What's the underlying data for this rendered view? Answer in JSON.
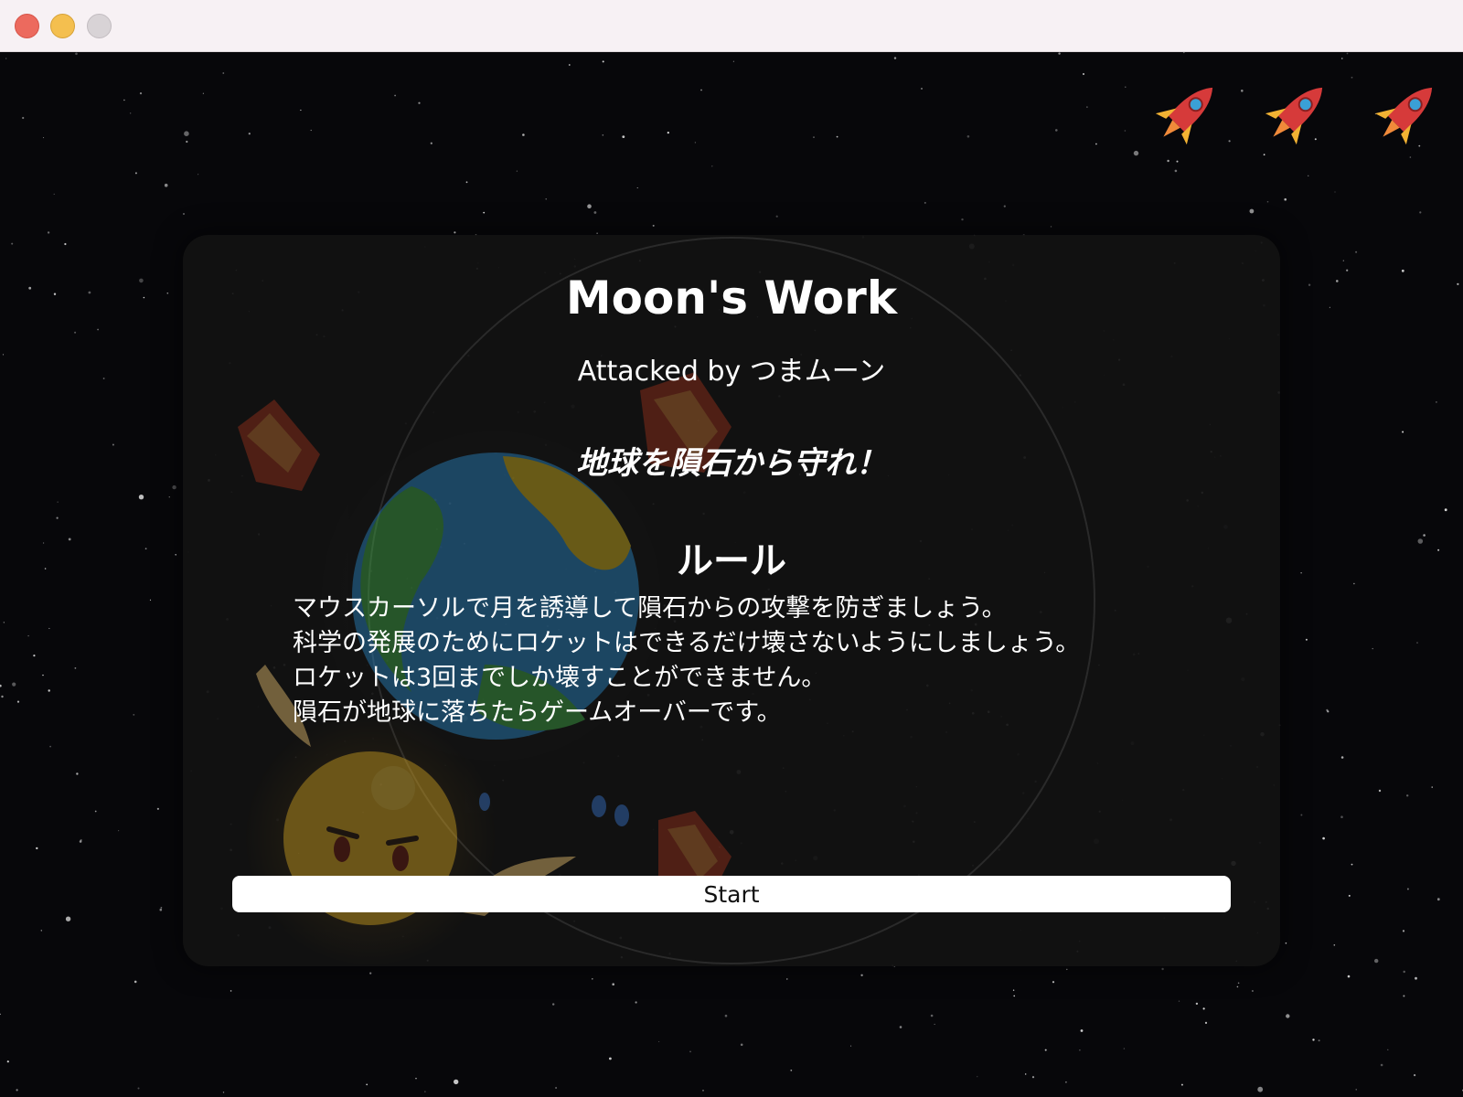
{
  "window": {
    "controls": [
      "close",
      "minimize",
      "maximize"
    ]
  },
  "lives": {
    "count": 3,
    "icon": "rocket-icon"
  },
  "dialog": {
    "title": "Moon's Work",
    "subtitle": "Attacked by つまムーン",
    "tagline": "地球を隕石から守れ！",
    "rules_heading": "ルール",
    "rules": [
      "マウスカーソルで月を誘導して隕石からの攻撃を防ぎましょう。",
      "科学の発展のためにロケットはできるだけ壊さないようにしましょう。",
      "ロケットは3回までしか壊すことができません。",
      "隕石が地球に落ちたらゲームオーバーです。"
    ],
    "start_label": "Start"
  },
  "colors": {
    "background": "#07070a",
    "dialog": "#121212",
    "rocket_body": "#d63a3a",
    "rocket_window": "#3aa0d6",
    "rocket_fin": "#f2b233"
  }
}
